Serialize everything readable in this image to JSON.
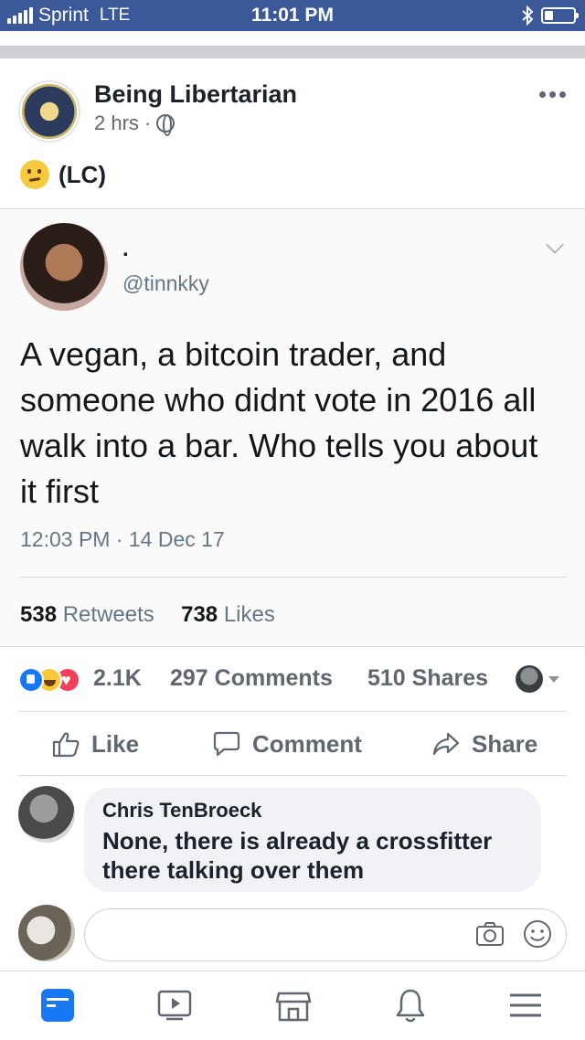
{
  "status_bar": {
    "carrier": "Sprint",
    "network": "LTE",
    "time": "11:01 PM"
  },
  "post": {
    "page_name": "Being Libertarian",
    "time_ago": "2 hrs",
    "meta_sep": "·",
    "caption": "(LC)",
    "emoji_icon": "thinking-face-icon"
  },
  "tweet": {
    "display_name": ".",
    "handle": "@tinnkky",
    "text": "A vegan, a bitcoin trader, and someone who didnt vote in 2016 all walk into a bar. Who tells you about it first",
    "timestamp": "12:03 PM · 14 Dec 17",
    "retweets_count": "538",
    "retweets_label": "Retweets",
    "likes_count": "738",
    "likes_label": "Likes"
  },
  "engagement": {
    "reactions_count": "2.1K",
    "comments": "297 Comments",
    "shares": "510 Shares"
  },
  "actions": {
    "like": "Like",
    "comment": "Comment",
    "share": "Share"
  },
  "comment": {
    "author": "Chris TenBroeck",
    "text": "None, there is already a crossfitter there talking over them"
  },
  "compose": {
    "placeholder": ""
  },
  "colors": {
    "brand": "#3b5998",
    "text_secondary": "#606770",
    "twitter_gray": "#657786"
  },
  "tab_bar": {
    "icons": [
      "news-feed-icon",
      "watch-icon",
      "marketplace-icon",
      "notifications-icon",
      "menu-icon"
    ]
  }
}
